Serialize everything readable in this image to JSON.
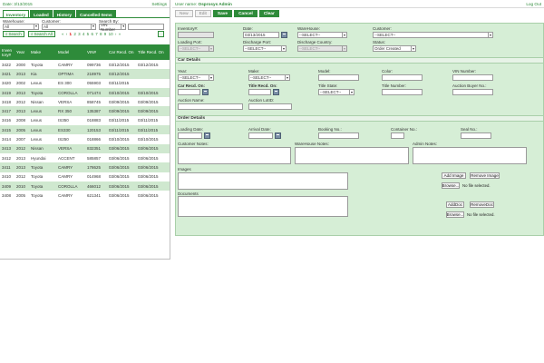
{
  "left": {
    "date_label": "Date: 3/13/2015",
    "settings": "Settings",
    "tabs": [
      "Inventory",
      "Loaded",
      "History",
      "Cancelled Items"
    ],
    "filters": {
      "warehouse_label": "Warehouse:",
      "warehouse_value": "All",
      "customer_label": "Customer:",
      "customer_value": "All",
      "searchby_label": "Search By:",
      "searchby_value": "VIN Number",
      "search_btn": "Search",
      "search_all_btn": "Search All",
      "pager": [
        "«",
        "‹",
        "1",
        "2",
        "3",
        "4",
        "5",
        "6",
        "7",
        "8",
        "9",
        "10",
        "›",
        "»"
      ],
      "pager_current": "1"
    },
    "columns": [
      "Inven tory#",
      "Year",
      "Make",
      "Model",
      "VIN#",
      "Car Recd. On",
      "Title Recd. On"
    ],
    "rows": [
      [
        "3422",
        "2000",
        "Toyota",
        "CAMRY",
        "099736",
        "03/12/2015",
        "03/12/2015"
      ],
      [
        "3421",
        "2013",
        "Kia",
        "OPTIMA",
        "218975",
        "03/12/2015",
        ""
      ],
      [
        "3420",
        "2002",
        "Lexus",
        "ES 300",
        "055903",
        "03/11/2015",
        ""
      ],
      [
        "3419",
        "2013",
        "Toyota",
        "COROLLA",
        "071474",
        "03/10/2015",
        "03/10/2015"
      ],
      [
        "3418",
        "2012",
        "Nissan",
        "VERSA",
        "858745",
        "03/09/2015",
        "03/09/2015"
      ],
      [
        "3417",
        "2013",
        "Lexus",
        "RX 350",
        "135387",
        "03/09/2015",
        "03/09/2015"
      ],
      [
        "3416",
        "2008",
        "Lexus",
        "IS350",
        "018883",
        "03/11/2015",
        "03/11/2015"
      ],
      [
        "3415",
        "2005",
        "Lexus",
        "ES330",
        "120153",
        "03/11/2015",
        "03/11/2015"
      ],
      [
        "3414",
        "2007",
        "Lexus",
        "IS250",
        "018866",
        "03/10/2015",
        "03/10/2015"
      ],
      [
        "3413",
        "2012",
        "Nissan",
        "VERSA",
        "832351",
        "03/06/2015",
        "03/06/2015"
      ],
      [
        "3412",
        "2013",
        "Hyundai",
        "ACCENT",
        "585857",
        "03/06/2015",
        "03/06/2015"
      ],
      [
        "3411",
        "2013",
        "Toyota",
        "CAMRY",
        "178625",
        "03/06/2015",
        "03/06/2015"
      ],
      [
        "3410",
        "2012",
        "Toyota",
        "CAMRY",
        "014968",
        "03/06/2015",
        "03/06/2015"
      ],
      [
        "3409",
        "2010",
        "Toyota",
        "COROLLA",
        "466012",
        "03/06/2015",
        "03/06/2015"
      ],
      [
        "3408",
        "2005",
        "Toyota",
        "CAMRY",
        "621341",
        "03/06/2015",
        "03/06/2015"
      ]
    ]
  },
  "right": {
    "user_prefix": "User name:",
    "user_name": "Osprosys Admin",
    "logout": "Log Out",
    "toolbar": [
      "New",
      "Edit",
      "Save",
      "Cancel",
      "Clear"
    ],
    "general": {
      "inventory_label": "Inventory#:",
      "date_label": "Date:",
      "date_value": "03/13/2015",
      "warehouse_label": "WareHouse:",
      "warehouse_value": "--SELECT--",
      "customer_label": "Customer:",
      "customer_value": "--SELECT--",
      "loading_port_label": "Loading Port:",
      "loading_port_value": "--SELECT--",
      "discharge_port_label": "Discharge Port:",
      "discharge_port_value": "--SELECT--",
      "discharge_country_label": "Discharge Country:",
      "discharge_country_value": "--SELECT--",
      "status_label": "Status:",
      "status_value": "Order Created"
    },
    "car": {
      "section_title": "Car Details",
      "year_label": "Year:",
      "year_value": "--SELECT--",
      "make_label": "Make:",
      "make_value": "--SELECT--",
      "model_label": "Model:",
      "color_label": "Color:",
      "vin_label": "VIN Number:",
      "car_recd_label": "Car Recd. On:",
      "title_recd_label": "Title Recd. On:",
      "title_state_label": "Title State:",
      "title_state_value": "--SELECT--",
      "title_number_label": "Title Number:",
      "auction_buyer_label": "Auction Buyer No.:",
      "auction_name_label": "Auction Name:",
      "auction_lotid_label": "Auction LotID:"
    },
    "order": {
      "section_title": "Order Details",
      "loading_date_label": "Loading Date:",
      "arrival_date_label": "Arrival Date:",
      "booking_label": "Booking No.:",
      "container_label": "Container No.:",
      "seal_label": "Seal No.:",
      "customer_notes_label": "Customer Notes:",
      "warehouse_notes_label": "WareHouse Notes:",
      "admin_notes_label": "Admin Notes:",
      "images_label": "Images",
      "add_image": "Add Image",
      "remove_image": "Remove Image",
      "browse": "Browse...",
      "no_file": "No file selected.",
      "documents_label": "Documents",
      "add_doc": "AddDoc",
      "remove_doc": "RemoveDoc"
    }
  }
}
